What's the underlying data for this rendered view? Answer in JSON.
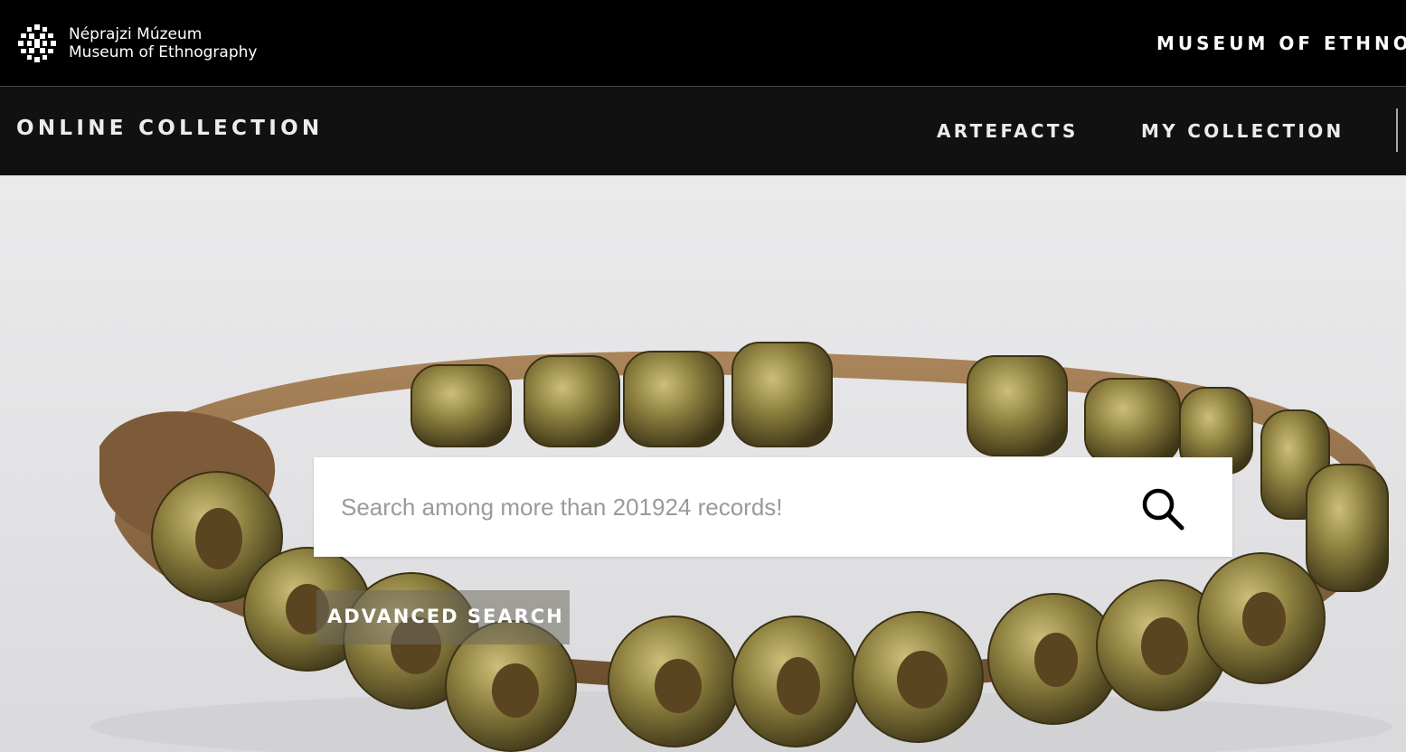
{
  "header": {
    "logo_line1": "Néprajzi Múzeum",
    "logo_line2": "Museum of Ethnography",
    "right_link": "MUSEUM OF ETHNOG"
  },
  "nav": {
    "title": "ONLINE COLLECTION",
    "links": [
      "ARTEFACTS",
      "MY COLLECTION"
    ]
  },
  "search": {
    "placeholder": "Search among more than 201924 records!",
    "value": ""
  },
  "advanced_search_label": "ADVANCED SEARCH",
  "hero": {
    "image_subject": "brass bead bracelet on leather cord"
  },
  "colors": {
    "header_bg": "#000000",
    "nav_bg": "#111111",
    "hero_bg": "#e6e6e8",
    "brass": "#8a7a3a",
    "leather": "#8c6a45"
  }
}
